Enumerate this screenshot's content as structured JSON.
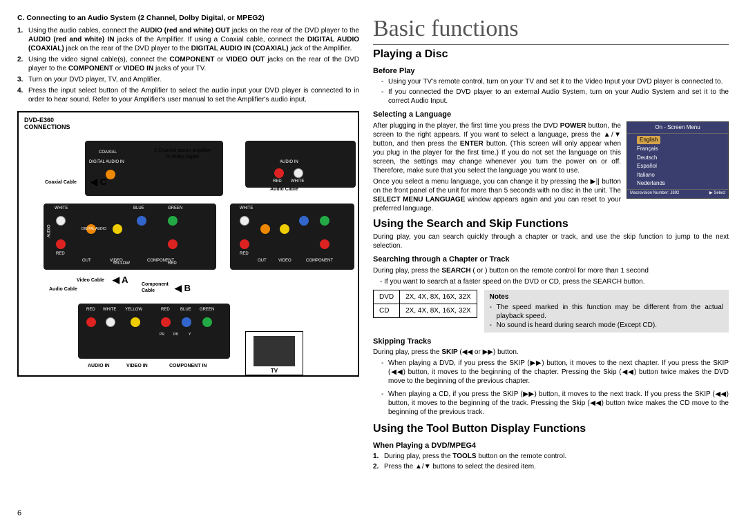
{
  "page_number": "6",
  "left": {
    "title": "C. Connecting to an Audio System (2 Channel, Dolby Digital, or MPEG2)",
    "steps": [
      {
        "n": "1.",
        "text_pre": "Using the audio cables, connect the ",
        "b1": "AUDIO (red and white) OUT",
        "mid1": " jacks on the rear of the DVD player to the ",
        "b2": "AUDIO (red and white) IN",
        "mid2": " jacks of the Amplifier. If using a Coaxial cable, connect the ",
        "b3": "DIGITAL AUDIO (COAXIAL)",
        "mid3": " jack on the rear of the DVD player to the ",
        "b4": "DIGITAL AUDIO IN (COAXIAL)",
        "end": " jack of the Amplifier."
      },
      {
        "n": "2.",
        "text_pre": "Using the video signal cable(s), connect the ",
        "b1": "COMPONENT",
        "mid1": " or ",
        "b2": "VIDEO OUT",
        "mid2": " jacks on the rear of the DVD player to the ",
        "b3": "COMPONENT",
        "mid3": " or ",
        "b4": "VIDEO IN",
        "end": " jacks of your TV."
      },
      {
        "n": "3.",
        "full": "Turn on your DVD player, TV, and Amplifier."
      },
      {
        "n": "4.",
        "full": "Press the input select button of the Amplifier to select the audio input your DVD player is connected to in order to hear sound. Refer to your Amplifier's user manual to set the Amplifier's audio input."
      }
    ],
    "diagram": {
      "header_line1": "DVD-E360",
      "header_line2": "CONNECTIONS",
      "amp_desc": "2-Channel stereo amplifier or Dolby Digital",
      "labels": {
        "coaxial": "COAXIAL",
        "digital_audio_in": "DIGITAL AUDIO IN",
        "audio_in": "AUDIO IN",
        "red": "RED",
        "white": "WHITE",
        "blue": "BLUE",
        "green": "GREEN",
        "yellow": "YELLOW",
        "audio": "AUDIO",
        "out": "OUT",
        "video": "VIDEO",
        "component": "COMPONENT",
        "digital_audio": "DIGITAL AUDIO",
        "coaxial_cable": "Coaxial Cable",
        "audio_cable": "Audio Cable",
        "video_cable": "Video Cable",
        "component_cable": "Component Cable",
        "audio_in2": "AUDIO IN",
        "video_in": "VIDEO IN",
        "component_in": "COMPONENT IN",
        "pb": "PB",
        "pr": "PR",
        "y": "Y",
        "tv": "TV"
      },
      "arrows": {
        "A": "A",
        "B": "B",
        "C": "C"
      }
    }
  },
  "right": {
    "big_title": "Basic functions",
    "play_title": "Playing a Disc",
    "before_play": "Before Play",
    "before_play_items": [
      "Using your TV's remote control, turn on your TV and set it to the Video Input your DVD player is connected to.",
      "If you connected the DVD player to an external Audio System, turn on your Audio System and set it to the correct Audio Input."
    ],
    "sel_lang_title": "Selecting a Language",
    "sel_lang_para1_pre": "After plugging in the player, the first time you press the DVD ",
    "sel_lang_power": "POWER",
    "sel_lang_para1_mid": " button, the screen to the right appears. If you want to select a language, press the ▲/▼ button, and then press the ",
    "sel_lang_enter": "ENTER",
    "sel_lang_para1_end": " button. (This screen will only appear when you plug in the player for the first time.) If you do not set the language on this screen, the settings may change whenever you turn the power on or off. Therefore, make sure that you select the language you want to use.",
    "sel_lang_para2_pre": "Once you select a menu language, you can change it by pressing the ▶|| button on the front panel of the unit for more than 5 seconds with no disc in the unit. The ",
    "sel_lang_select_menu": "SELECT MENU LANGUAGE",
    "sel_lang_para2_end": " window appears again and you can reset to your preferred language.",
    "osd": {
      "title": "On - Screen Menu",
      "items": [
        "English",
        "Français",
        "Deutsch",
        "Español",
        "Italiano",
        "Nederlands"
      ],
      "foot_left": "Macrovision Number: J892",
      "foot_right": "▶ Select"
    },
    "search_title": "Using the Search and Skip Functions",
    "search_intro": "During play, you can search quickly through a chapter or track, and use the skip function to jump to the next selection.",
    "search_chap_title": "Searching through a Chapter or Track",
    "search_chap_p1_pre": "During play,  press the ",
    "search_chap_search": "SEARCH",
    "search_chap_p1_end": " (    or    ) button on the remote control for more than 1 second",
    "search_chap_p2": "- If you want to search at a faster speed on the DVD or CD, press the SEARCH button.",
    "speed_table": {
      "rows": [
        {
          "label": "DVD",
          "speeds": "2X, 4X, 8X, 16X, 32X"
        },
        {
          "label": "CD",
          "speeds": "2X, 4X, 8X, 16X, 32X"
        }
      ]
    },
    "notes_title": "Notes",
    "notes": [
      "The speed marked in this function may be different from the actual playback speed.",
      "No sound is heard during search mode (Except CD)."
    ],
    "skip_title": "Skipping Tracks",
    "skip_para_pre": "During play, press the ",
    "skip_word": "SKIP",
    "skip_para_end": " (◀◀ or ▶▶) button.",
    "skip_dvd": "When playing a DVD, if you press the SKIP (▶▶) button, it moves to the next chapter. If you press the SKIP (◀◀) button, it moves to the beginning of the chapter. Pressing the Skip (◀◀) button twice makes the DVD move to the beginning of the previous chapter.",
    "skip_cd": "When playing a CD, if you press the SKIP (▶▶) button, it moves to the next track. If you press the SKIP (◀◀) button, it moves to the beginning of the track. Pressing the Skip (◀◀) button twice makes the CD move to the beginning of the previous track.",
    "tool_title": "Using the Tool Button Display Functions",
    "tool_sub": "When Playing a DVD/MPEG4",
    "tool_steps": [
      {
        "n": "1.",
        "pre": "During play, press the ",
        "b": "TOOLS",
        "post": " button on the remote control."
      },
      {
        "n": "2.",
        "full": "Press the ▲/▼ buttons to select the desired item."
      }
    ]
  }
}
